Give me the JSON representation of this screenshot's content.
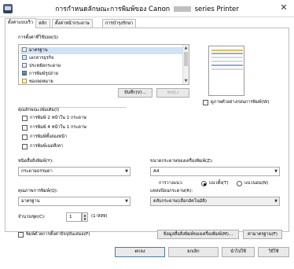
{
  "window": {
    "title_prefix": "การกำหนดลักษณะการพิมพ์ของ Canon",
    "title_suffix": "series Printer",
    "close_glyph": "✕"
  },
  "tabs": [
    {
      "label": "ตั้งค่าแบบเร็ว",
      "active": true
    },
    {
      "label": "หลัก",
      "active": false
    },
    {
      "label": "ตั้งค่าหน้ากระดาษ",
      "active": false
    },
    {
      "label": "การบำรุงรักษา",
      "active": false
    }
  ],
  "common_settings": {
    "label": "การตั้งค่าที่ใช้บ่อย(S)",
    "items": [
      {
        "label": "มาตรฐาน",
        "icon": "standard-icon",
        "selected": true
      },
      {
        "label": "เอกสารธุรกิจ",
        "icon": "business-document-icon",
        "selected": false
      },
      {
        "label": "ประหยัดกระดาษ",
        "icon": "paper-saving-icon",
        "selected": false
      },
      {
        "label": "การพิมพ์รูปถ่าย",
        "icon": "photo-printing-icon",
        "selected": false
      },
      {
        "label": "ซองจดหมาย",
        "icon": "envelope-icon",
        "selected": false
      }
    ],
    "save_button": "บันทึก(V)...",
    "delete_button": "ลบ(L)"
  },
  "preview": {
    "checkbox_label": "ดูภาพตัวอย่างก่อนการพิมพ์(W)",
    "checked": false
  },
  "additional_features": {
    "label": "คุณลักษณะเพิ่มเติม(I)",
    "options": [
      {
        "label": "การพิมพ์ 2 หน้าใน 1 กระดาษ",
        "checked": false
      },
      {
        "label": "การพิมพ์ 4 หน้าใน 1 กระดาษ",
        "checked": false
      },
      {
        "label": "การพิมพ์ทั้งสองหน้า",
        "checked": false
      },
      {
        "label": "การพิมพ์เฉดสีเทา",
        "checked": false
      }
    ]
  },
  "media_type": {
    "label": "ชนิดสื่อสิ่งพิมพ์(Y):",
    "value": "กระดาษธรรมดา"
  },
  "printer_paper_size": {
    "label": "ขนาดกระดาษของเครื่องพิมพ์(Z):",
    "value": "A4"
  },
  "orientation": {
    "label": "การวางแนว:",
    "options": [
      {
        "label": "แนวตั้ง(T)",
        "selected": true
      },
      {
        "label": "แนวนอน(N)",
        "selected": false
      }
    ]
  },
  "print_quality": {
    "label": "คุณภาพการพิมพ์(Q):",
    "value": "มาตรฐาน"
  },
  "paper_source": {
    "label": "แหล่งป้อนกระดาษ(R):",
    "value": "ตลับกระดาษ(เลือกอัตโนมัติ)"
  },
  "copies": {
    "label": "จำนวนชุด(C):",
    "value": "1",
    "range": "(1-999)"
  },
  "always_print": {
    "label": "พิมพ์ด้วยการตั้งค่าปัจจุบันเสมอ(P)",
    "checked": false
  },
  "buttons": {
    "printer_media_info": "ข้อมูลสื่อสิ่งพิมพ์ของเครื่องพิมพ์(M)...",
    "defaults": "ค่ามาตรฐาน(F)",
    "ok": "ตกลง",
    "cancel": "ยกเลิก",
    "apply": "นำไปใช้",
    "help": "วิธีใช้"
  },
  "colors": {
    "selected_item": "#cfe3f7",
    "default_button_border": "#3c7fb1",
    "preview_band_1": "#e9b85a",
    "preview_band_2": "#8ab0de",
    "preview_band_3": "#d8d8d8"
  }
}
